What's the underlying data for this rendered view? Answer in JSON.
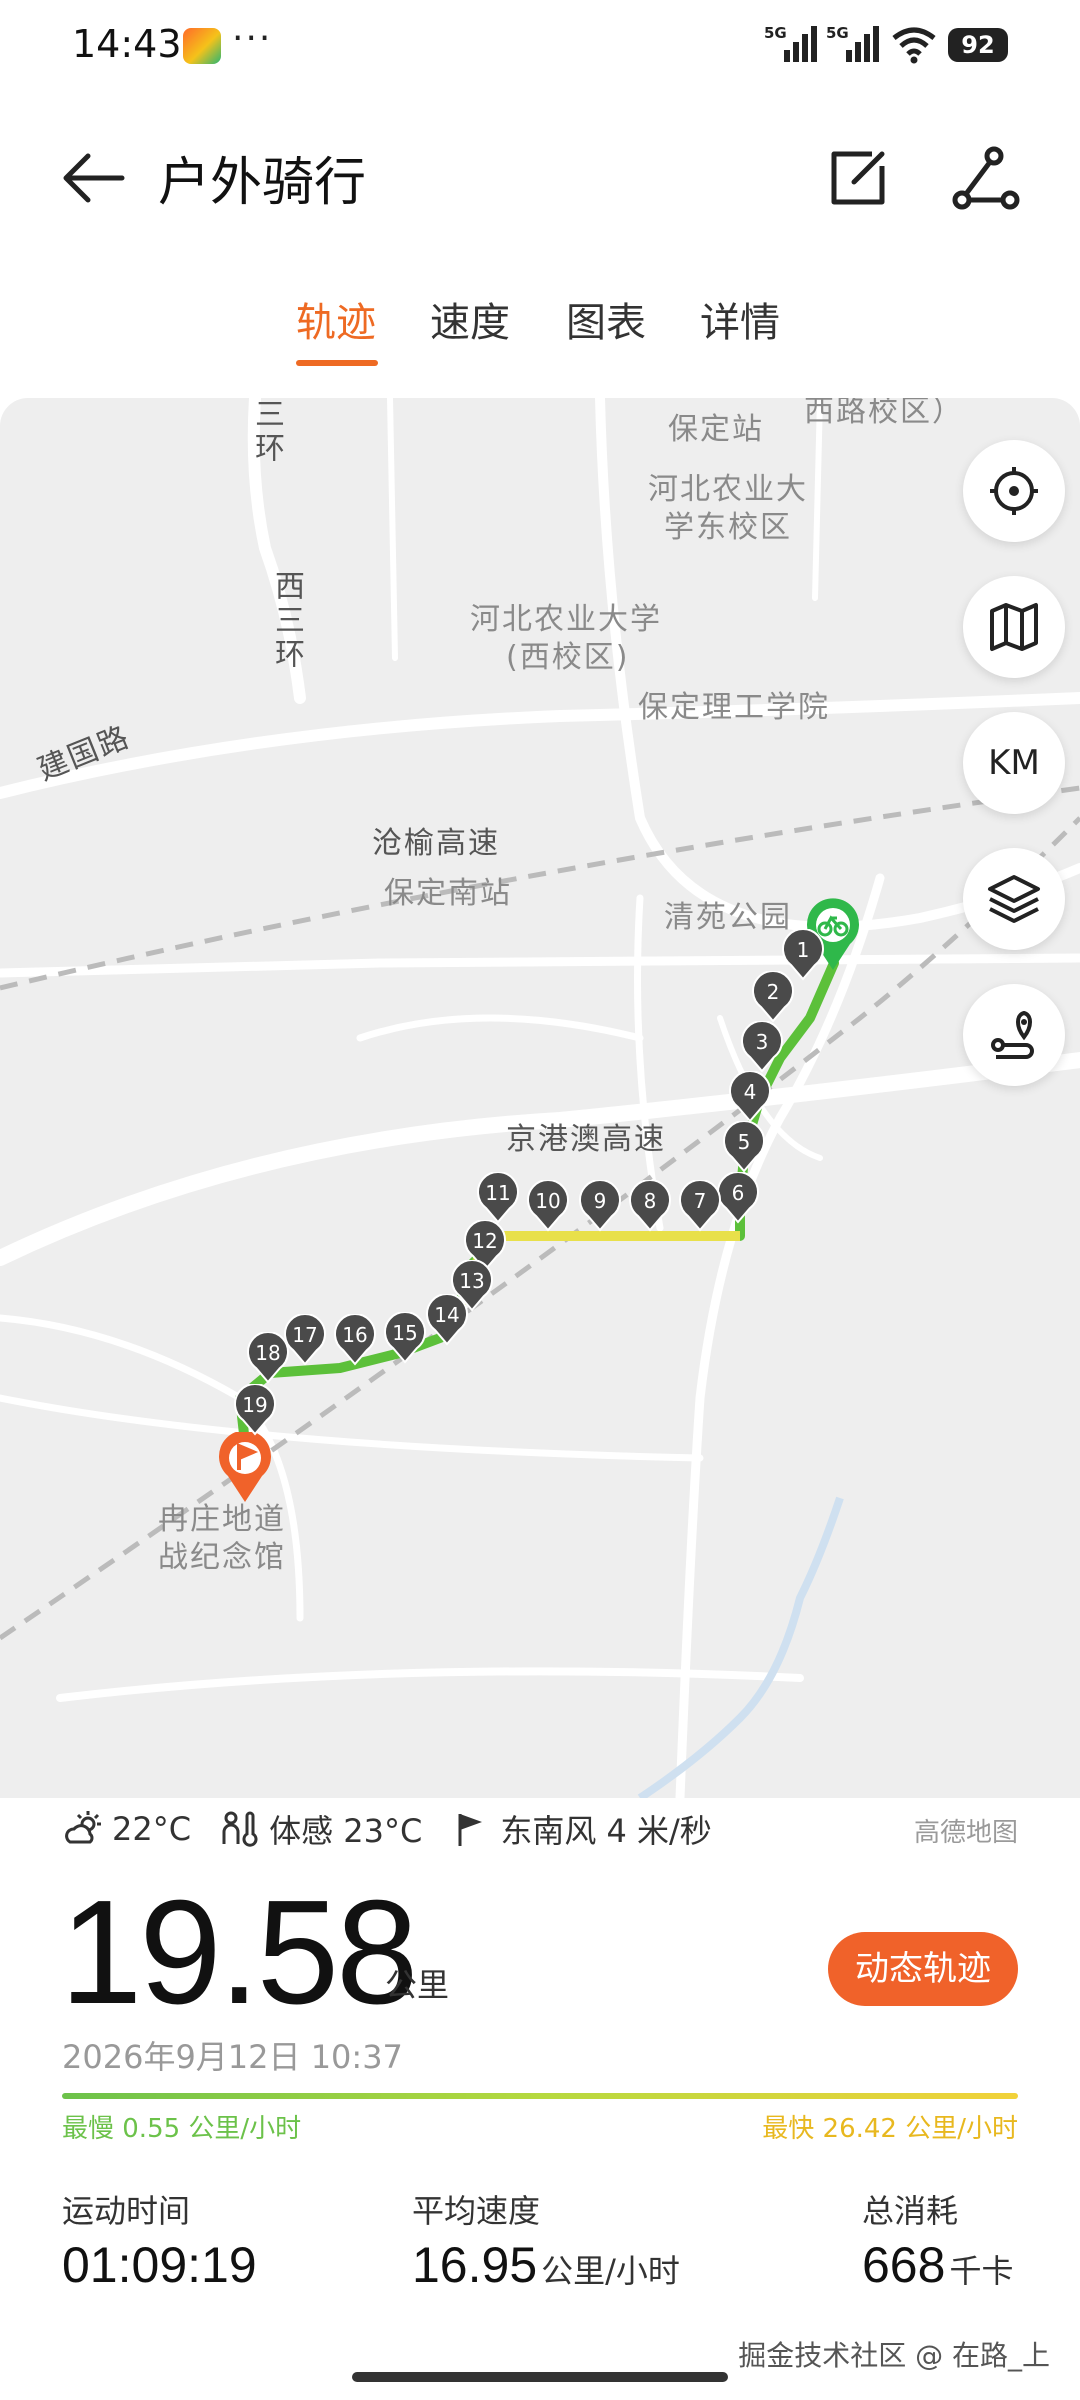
{
  "status_bar": {
    "time": "14:43",
    "dots": "···",
    "signal1_label": "5G",
    "signal2_label": "5G",
    "battery": "92"
  },
  "header": {
    "title": "户外骑行",
    "back_icon": "arrow-left-icon",
    "edit_icon": "edit-icon",
    "share_icon": "share-icon"
  },
  "tabs": [
    {
      "label": "轨迹",
      "active": true
    },
    {
      "label": "速度",
      "active": false
    },
    {
      "label": "图表",
      "active": false
    },
    {
      "label": "详情",
      "active": false
    }
  ],
  "map": {
    "labels": {
      "san_huan": "三环",
      "xi_san_huan": "西三环",
      "xilu_xiaoqu": "西路校区）",
      "baoding_station": "保定站",
      "hebei_agri_east_1": "河北农业大",
      "hebei_agri_east_2": "学东校区",
      "hebei_agri_west_1": "河北农业大学",
      "hebei_agri_west_2": "(西校区)",
      "baoding_tech": "保定理工学院",
      "jianguo_road": "建国路",
      "cangyu_expressway": "沧榆高速",
      "baoding_south": "保定南站",
      "qingyuan_park": "清苑公园",
      "jinggangao": "京港澳高速",
      "ranzhuang_1": "冉庄地道",
      "ranzhuang_2": "战纪念馆"
    },
    "km_markers": [
      "1",
      "2",
      "3",
      "4",
      "5",
      "6",
      "7",
      "8",
      "9",
      "10",
      "11",
      "12",
      "13",
      "14",
      "15",
      "16",
      "17",
      "18",
      "19"
    ],
    "buttons": {
      "locate_icon": "locate-icon",
      "map_type_icon": "map-icon",
      "km_label": "KM",
      "layers_icon": "layers-icon",
      "route_icon": "route-icon"
    },
    "credit": "高德地图",
    "colors": {
      "start": "#2fb84a",
      "end": "#f0622a",
      "marker": "#4a4a4a"
    }
  },
  "weather": {
    "temp": "22°C",
    "feels_like": "体感 23°C",
    "wind": "东南风 4 米/秒"
  },
  "summary": {
    "distance": "19.58",
    "distance_unit": "公里",
    "replay_button": "动态轨迹",
    "datetime": "2026年9月12日 10:37",
    "slowest": "最慢 0.55 公里/小时",
    "fastest": "最快 26.42 公里/小时"
  },
  "stats": {
    "duration_label": "运动时间",
    "duration_value": "01:09:19",
    "avg_speed_label": "平均速度",
    "avg_speed_value": "16.95",
    "avg_speed_unit": "公里/小时",
    "calories_label": "总消耗",
    "calories_value": "668",
    "calories_unit": "千卡"
  },
  "watermark": "掘金技术社区 @ 在路_上"
}
